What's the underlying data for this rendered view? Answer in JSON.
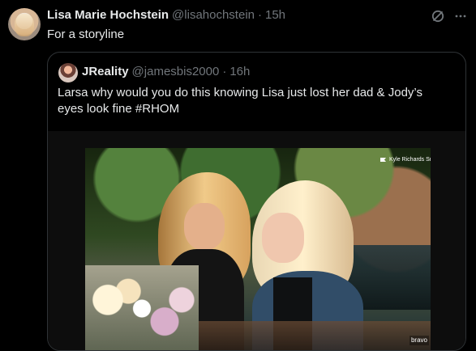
{
  "tweet": {
    "author_name": "Lisa Marie Hochstein",
    "author_handle": "@lisahochstein",
    "separator": "·",
    "time": "15h",
    "text": "For a storyline"
  },
  "quote": {
    "author_name": "JReality",
    "author_handle": "@jamesbis2000",
    "separator": "·",
    "time": "16h",
    "text": "Larsa why would you do this knowing Lisa just lost her dad & Jody’s eyes look fine #RHOM"
  },
  "video": {
    "caption": "Kyle Richards Snoop",
    "close": "×",
    "watermark": "bravo"
  },
  "icons": {
    "grok": "grok-icon",
    "more": "more-icon",
    "flag": "flag-icon",
    "close": "close-icon"
  }
}
